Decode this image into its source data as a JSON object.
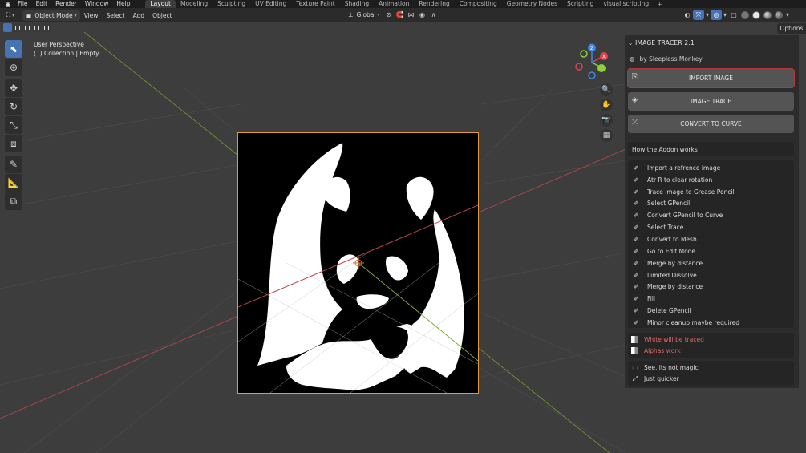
{
  "menubar": {
    "menus": [
      "File",
      "Edit",
      "Render",
      "Window",
      "Help"
    ],
    "workspaces": [
      {
        "label": "Layout",
        "active": true
      },
      {
        "label": "Modeling",
        "active": false
      },
      {
        "label": "Sculpting",
        "active": false
      },
      {
        "label": "UV Editing",
        "active": false
      },
      {
        "label": "Texture Paint",
        "active": false
      },
      {
        "label": "Shading",
        "active": false
      },
      {
        "label": "Animation",
        "active": false
      },
      {
        "label": "Rendering",
        "active": false
      },
      {
        "label": "Compositing",
        "active": false
      },
      {
        "label": "Geometry Nodes",
        "active": false
      },
      {
        "label": "Scripting",
        "active": false
      },
      {
        "label": "visual scripting",
        "active": false
      }
    ],
    "add_tab": "+"
  },
  "header": {
    "mode": "Object Mode",
    "menus": [
      "View",
      "Select",
      "Add",
      "Object"
    ],
    "transform_orientation": "Global"
  },
  "viewport": {
    "view_name": "User Perspective",
    "collection_info": "(1) Collection | Empty",
    "gizmo_axes": {
      "x": "X",
      "y": "Y",
      "z": "Z"
    }
  },
  "sidebar": {
    "options_tab": "Options",
    "panel_title": "IMAGE TRACER 2.1",
    "author": "by Sleepless Monkey",
    "buttons": {
      "import": "IMPORT IMAGE",
      "trace": "IMAGE TRACE",
      "convert": "CONVERT TO CURVE"
    },
    "how_title": "How the Addon works",
    "steps": [
      "Import a refrence image",
      "Atr R to clear rotation",
      "Trace image to Grease Pencil",
      "Select GPencil",
      "Convert GPencil to Curve",
      "Select Trace",
      "Convert to Mesh",
      "Go to Edit Mode",
      "Merge by distance",
      "Limited Dissolve",
      "Merge by distance",
      "Fill",
      "Delete GPencil",
      "Minor cleanup maybe required"
    ],
    "notes_red": [
      "White will be traced",
      "Alphas work"
    ],
    "notes": [
      "See, its not magic",
      "Just quicker"
    ]
  },
  "colors": {
    "accent": "#4772b3",
    "selection_outline": "#e89a2a",
    "warning_text": "#e06666",
    "axis_x": "#e0434a",
    "axis_y": "#8fcf3a",
    "axis_z": "#3f86e6"
  }
}
